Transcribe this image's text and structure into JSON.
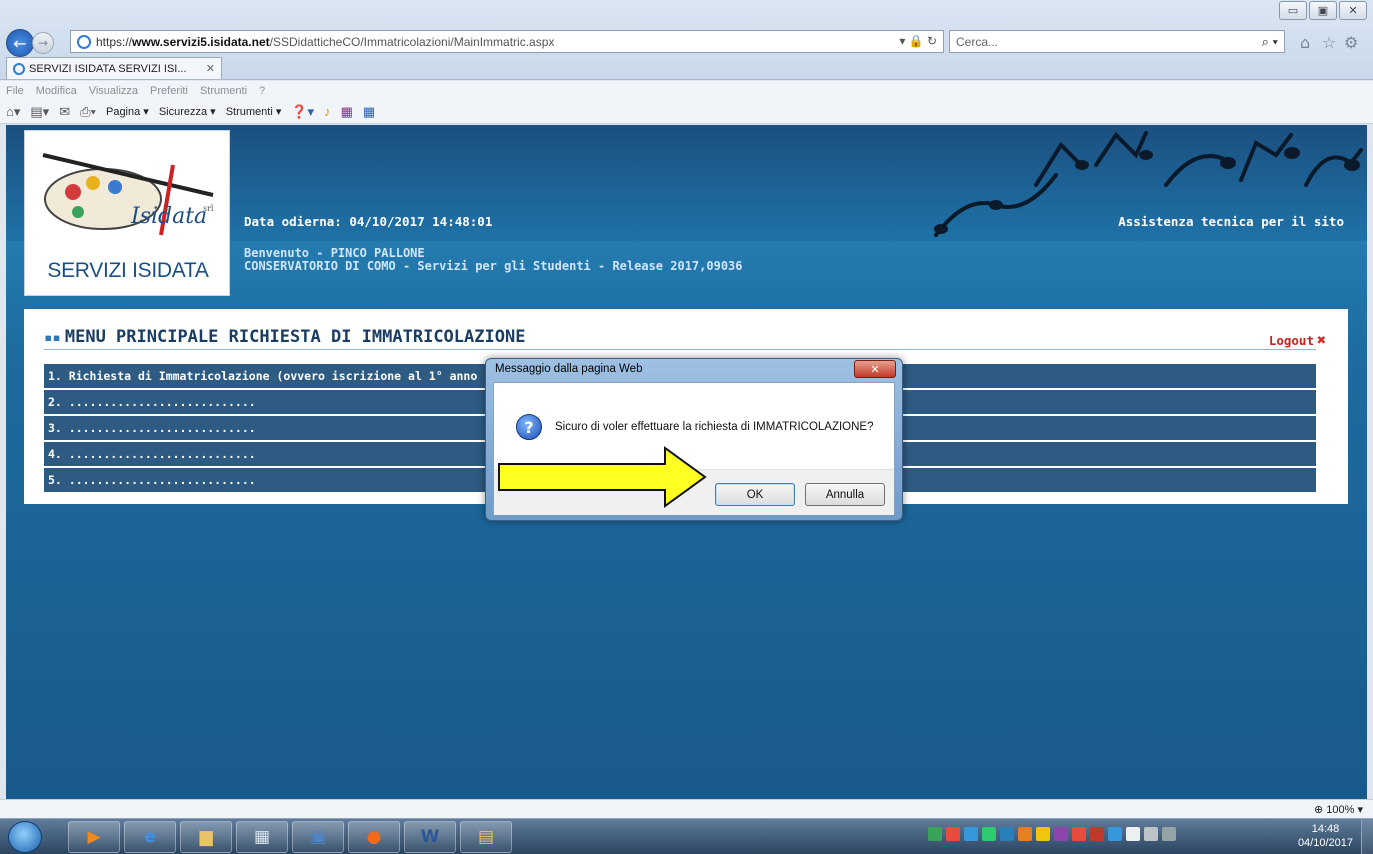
{
  "browser": {
    "url_scheme": "https://",
    "url_host": "www.servizi5.isidata.net",
    "url_path": "/SSDidatticheCO/Immatricolazioni/MainImmatric.aspx",
    "search_placeholder": "Cerca...",
    "tab_title": "SERVIZI ISIDATA SERVIZI ISI...",
    "menu": [
      "File",
      "Modifica",
      "Visualizza",
      "Preferiti",
      "Strumenti",
      "?"
    ],
    "commands": [
      "Pagina ▾",
      "Sicurezza ▾",
      "Strumenti ▾"
    ],
    "zoom": "100%"
  },
  "header": {
    "logo_text": "SERVIZI ISIDATA",
    "logo_brand": "Isidata",
    "logo_srl": "srl",
    "date": "Data odierna: 04/10/2017 14:48:01",
    "assistance": "Assistenza tecnica per il sito",
    "welcome": "Benvenuto - PINCO PALLONE",
    "institute": "CONSERVATORIO DI COMO - Servizi per gli Studenti - Release 2017,09036"
  },
  "panel": {
    "title": "MENU PRINCIPALE RICHIESTA DI IMMATRICOLAZIONE",
    "logout": "Logout",
    "items": [
      "1. Richiesta di Immatricolazione (ovvero iscrizione al 1° anno - dopo il superamento positivo dell'esame di ammissione)",
      "2. ...........................",
      "3. ...........................",
      "4. ...........................",
      "5. ..........................."
    ]
  },
  "dialog": {
    "title": "Messaggio dalla pagina Web",
    "message": "Sicuro di voler effettuare la richiesta di IMMATRICOLAZIONE?",
    "ok": "OK",
    "cancel": "Annulla"
  },
  "taskbar": {
    "time": "14:48",
    "date": "04/10/2017"
  }
}
